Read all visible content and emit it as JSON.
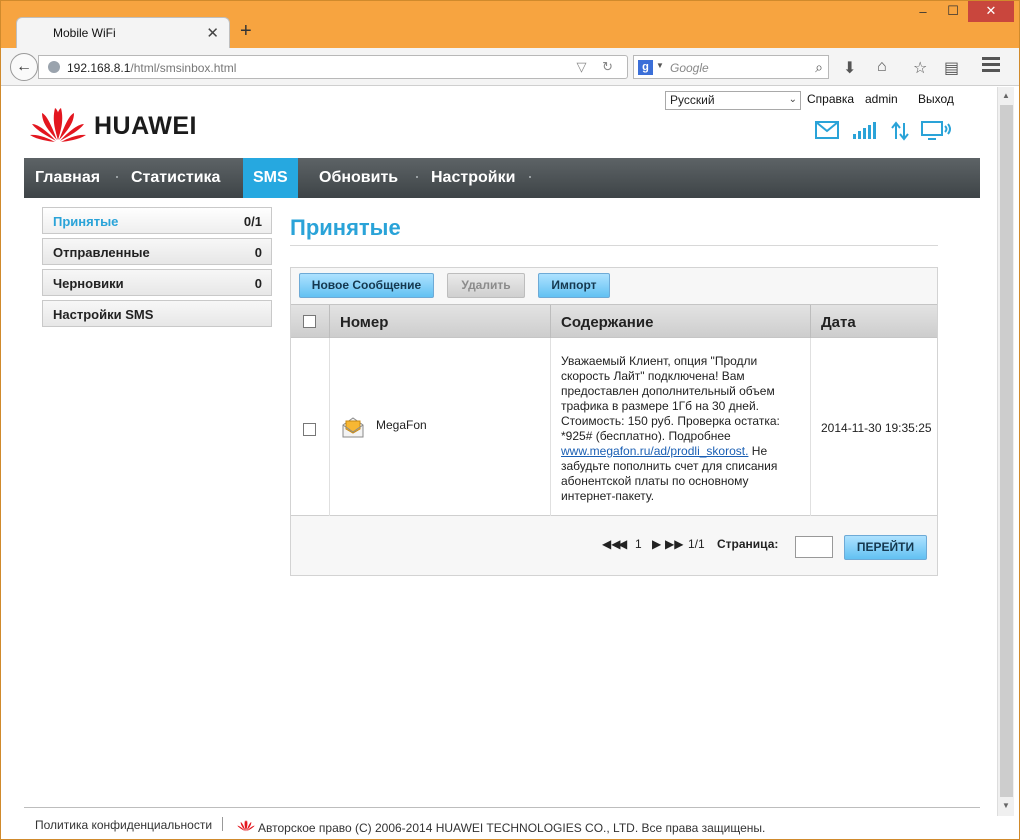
{
  "browser": {
    "tab_title": "Mobile WiFi",
    "tab_close": "✕",
    "new_tab": "+",
    "url_host": "192.168.8.1",
    "url_path": "/html/smsinbox.html",
    "search_placeholder": "Google",
    "window_controls": [
      "–",
      "☐",
      "✕"
    ]
  },
  "header": {
    "language": "Русский",
    "help": "Справка",
    "user": "admin",
    "logout": "Выход",
    "logo_text": "HUAWEI",
    "status_icons": [
      "mail-icon",
      "signal-icon",
      "data-transfer-icon",
      "pc-connected-icon"
    ]
  },
  "nav": {
    "items": [
      {
        "label": "Главная"
      },
      {
        "label": "Статистика"
      },
      {
        "label": "SMS",
        "active": true
      },
      {
        "label": "Обновить"
      },
      {
        "label": "Настройки"
      }
    ]
  },
  "sidebar": {
    "items": [
      {
        "label": "Принятые",
        "count": "0/1",
        "active": true
      },
      {
        "label": "Отправленные",
        "count": "0"
      },
      {
        "label": "Черновики",
        "count": "0"
      },
      {
        "label": "Настройки SMS",
        "count": ""
      }
    ]
  },
  "content": {
    "title": "Принятые",
    "buttons": {
      "new": "Новое Сообщение",
      "delete": "Удалить",
      "import": "Импорт"
    },
    "columns": [
      "Номер",
      "Содержание",
      "Дата"
    ],
    "messages": [
      {
        "sender": "MegaFon",
        "text_before": "Уважаемый Клиент, опция \"Продли скорость Лайт\" подключена! Вам предоставлен дополнительный объем трафика в размере 1Гб на 30 дней. Стоимость: 150 руб. Проверка остатка: *925# (бесплатно). Подробнее ",
        "link": "www.megafon.ru/ad/prodli_skorost.",
        "text_after": " Не забудьте пополнить счет для списания абонентской платы по основному интернет-пакету.",
        "date": "2014-11-30 19:35:25"
      }
    ],
    "pager": {
      "current": "1",
      "total": "1/1",
      "page_label": "Страница:",
      "go": "ПЕРЕЙТИ"
    }
  },
  "footer": {
    "privacy": "Политика конфиденциальности",
    "copyright": "Авторское право (C) 2006-2014 HUAWEI TECHNOLOGIES CO., LTD. Все права защищены."
  },
  "colors": {
    "accent": "#26a8e0",
    "title_bar": "#f7a440",
    "nav_bg": "#4a5053"
  }
}
